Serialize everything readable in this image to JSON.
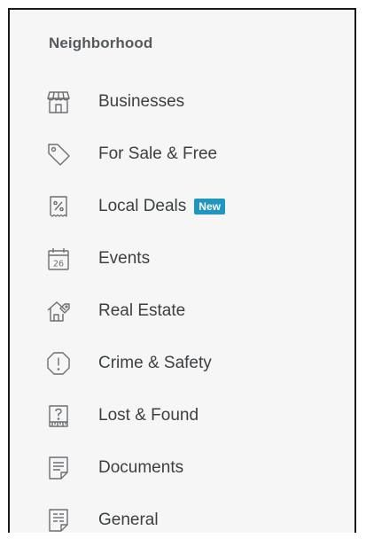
{
  "sidebar": {
    "heading": "Neighborhood",
    "items": [
      {
        "label": "Businesses",
        "icon": "storefront-icon"
      },
      {
        "label": "For Sale & Free",
        "icon": "price-tag-icon"
      },
      {
        "label": "Local Deals",
        "icon": "coupon-percent-icon",
        "badge": "New"
      },
      {
        "label": "Events",
        "icon": "calendar-icon",
        "icon_text": "26"
      },
      {
        "label": "Real Estate",
        "icon": "house-tag-icon"
      },
      {
        "label": "Crime & Safety",
        "icon": "alert-octagon-icon"
      },
      {
        "label": "Lost & Found",
        "icon": "question-note-icon"
      },
      {
        "label": "Documents",
        "icon": "document-icon"
      },
      {
        "label": "General",
        "icon": "note-icon"
      }
    ]
  },
  "colors": {
    "panel_background": "#f6f6f6",
    "heading_text": "#555a5e",
    "item_text": "#3b3f42",
    "icon_stroke": "#6b6f72",
    "badge_background": "#1f96bd",
    "badge_text": "#ffffff"
  }
}
